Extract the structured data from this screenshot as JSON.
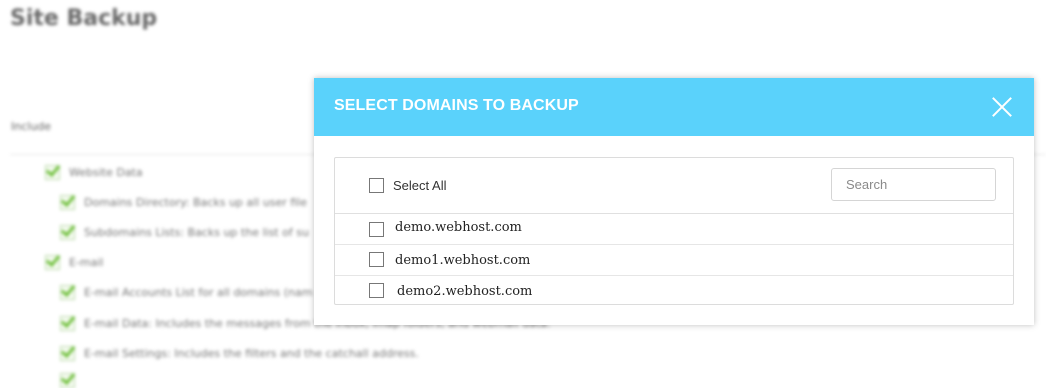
{
  "page": {
    "title": "Site Backup",
    "include_label": "Include",
    "options": [
      "Website Data",
      "Domains Directory: Backs up all user file",
      "Subdomains Lists: Backs up the list of su",
      "E-mail",
      "E-mail Accounts List for all domains (nam",
      "E-mail Data: Includes the messages from the inbox, imap folders, and webmail data.",
      "E-mail Settings: Includes the filters and the catchall address."
    ]
  },
  "modal": {
    "title": "SELECT DOMAINS TO BACKUP",
    "select_all": {
      "label": "Select All",
      "checked": false
    },
    "search": {
      "placeholder": "Search",
      "value": ""
    },
    "domains": [
      {
        "name": "demo.webhost.com",
        "checked": false
      },
      {
        "name": "demo1.webhost.com",
        "checked": false
      },
      {
        "name": "demo2.webhost.com",
        "checked": false
      }
    ]
  },
  "colors": {
    "header": "#5ad2fb",
    "check_green": "#6fbf3b"
  }
}
